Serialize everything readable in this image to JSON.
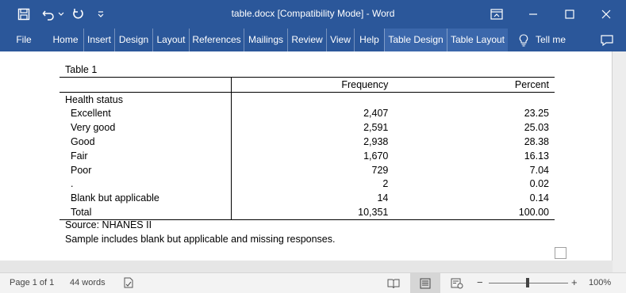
{
  "titlebar": {
    "title": "table.docx [Compatibility Mode]  -  Word",
    "icons": [
      "save-icon",
      "undo-icon",
      "redo-icon",
      "customize-icon",
      "ribbon-display-icon",
      "minimize-icon",
      "maximize-icon",
      "close-icon"
    ]
  },
  "ribbon": {
    "tabs": [
      "File",
      "Home",
      "Insert",
      "Design",
      "Layout",
      "References",
      "Mailings",
      "Review",
      "View",
      "Help",
      "Table Design",
      "Table Layout"
    ],
    "tell_me": "Tell me"
  },
  "document": {
    "caption": "Table 1",
    "columns": [
      "",
      "Frequency",
      "Percent"
    ],
    "group_label": "Health status",
    "rows": [
      {
        "label": "Excellent",
        "frequency": "2,407",
        "percent": "23.25"
      },
      {
        "label": "Very good",
        "frequency": "2,591",
        "percent": "25.03"
      },
      {
        "label": "Good",
        "frequency": "2,938",
        "percent": "28.38"
      },
      {
        "label": "Fair",
        "frequency": "1,670",
        "percent": "16.13"
      },
      {
        "label": "Poor",
        "frequency": "729",
        "percent": "7.04"
      },
      {
        "label": ".",
        "frequency": "2",
        "percent": "0.02"
      },
      {
        "label": "Blank but applicable",
        "frequency": "14",
        "percent": "0.14"
      },
      {
        "label": "Total",
        "frequency": "10,351",
        "percent": "100.00"
      }
    ],
    "source": "Source: NHANES II",
    "note": "Sample includes blank but applicable and missing responses."
  },
  "statusbar": {
    "page": "Page 1 of 1",
    "words": "44 words",
    "zoom_out": "−",
    "zoom_in": "+",
    "zoom": "100%",
    "zoom_level_percent": 100
  }
}
